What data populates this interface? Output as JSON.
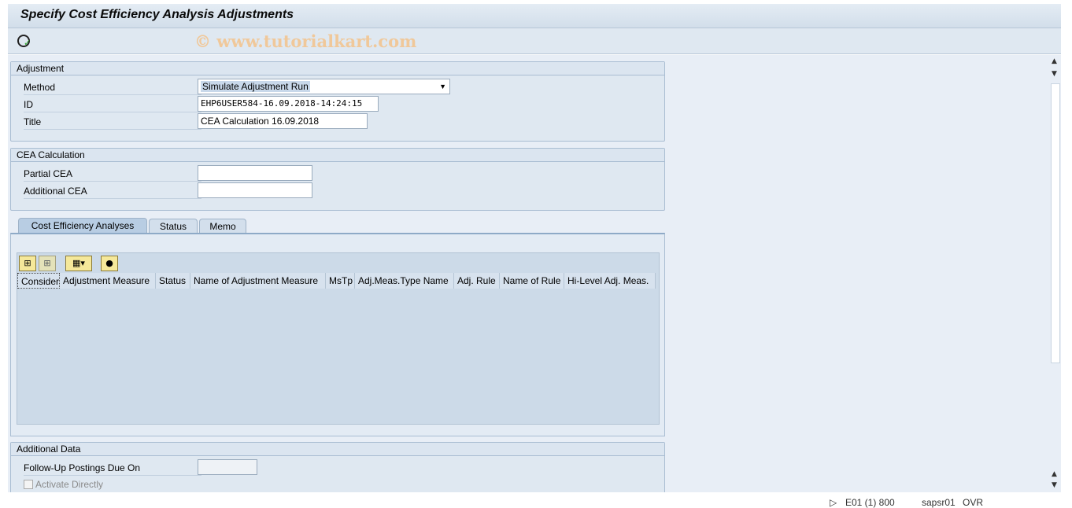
{
  "title": "Specify Cost Efficiency Analysis Adjustments",
  "watermark": "© www.tutorialkart.com",
  "adjustment": {
    "header": "Adjustment",
    "method_label": "Method",
    "method_value": "Simulate Adjustment Run",
    "id_label": "ID",
    "id_value": "EHP6USER584-16.09.2018-14:24:15",
    "title_label": "Title",
    "title_value": "CEA Calculation 16.09.2018"
  },
  "cea": {
    "header": "CEA Calculation",
    "partial_label": "Partial CEA",
    "partial_value": "",
    "additional_label": "Additional CEA",
    "additional_value": ""
  },
  "tabs": [
    {
      "label": "Cost Efficiency Analyses",
      "active": true
    },
    {
      "label": "Status"
    },
    {
      "label": "Memo"
    }
  ],
  "grid": {
    "columns": [
      "Consider",
      "Adjustment Measure",
      "Status",
      "Name of Adjustment Measure",
      "MsTp",
      "Adj.Meas.Type Name",
      "Adj. Rule",
      "Name of Rule",
      "Hi-Level Adj. Meas."
    ],
    "rows": []
  },
  "additional": {
    "header": "Additional Data",
    "followup_label": "Follow-Up Postings Due On",
    "followup_value": "",
    "activate_label": "Activate Directly",
    "activate_checked": false
  },
  "statusbar": {
    "system": "E01 (1) 800",
    "server": "sapsr01",
    "mode": "OVR"
  }
}
